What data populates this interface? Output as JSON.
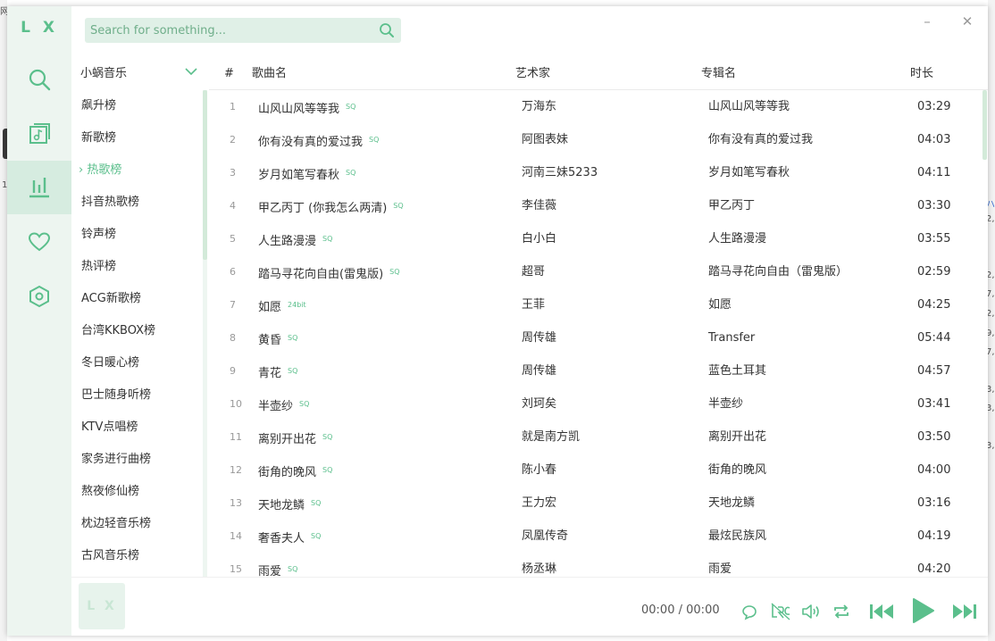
{
  "app": {
    "logo": "L X"
  },
  "search": {
    "placeholder": "Search for something..."
  },
  "window": {
    "minimize": "–",
    "close": "✕"
  },
  "sidebar_nav": [
    "search-icon",
    "music-library-icon",
    "chart-icon",
    "heart-icon",
    "settings-hex-icon"
  ],
  "source": {
    "selected": "小蜗音乐"
  },
  "chart_lists": [
    "飙升榜",
    "新歌榜",
    "热歌榜",
    "抖音热歌榜",
    "铃声榜",
    "热评榜",
    "ACG新歌榜",
    "台湾KKBOX榜",
    "冬日暖心榜",
    "巴士随身听榜",
    "KTV点唱榜",
    "家务进行曲榜",
    "熬夜修仙榜",
    "枕边轻音乐榜",
    "古风音乐榜"
  ],
  "active_list_marker": "›",
  "table": {
    "headers": {
      "num": "#",
      "name": "歌曲名",
      "artist": "艺术家",
      "album": "专辑名",
      "duration": "时长"
    },
    "rows": [
      {
        "num": "1",
        "name": "山风山风等等我",
        "tag": "SQ",
        "artist": "万海东",
        "album": "山风山风等等我",
        "duration": "03:29"
      },
      {
        "num": "2",
        "name": "你有没有真的爱过我",
        "tag": "SQ",
        "artist": "阿图表妹",
        "album": "你有没有真的爱过我",
        "duration": "04:03"
      },
      {
        "num": "3",
        "name": "岁月如笔写春秋",
        "tag": "SQ",
        "artist": "河南三妹5233",
        "album": "岁月如笔写春秋",
        "duration": "04:11"
      },
      {
        "num": "4",
        "name": "甲乙丙丁 (你我怎么两清)",
        "tag": "SQ",
        "artist": "李佳薇",
        "album": "甲乙丙丁",
        "duration": "03:30"
      },
      {
        "num": "5",
        "name": "人生路漫漫",
        "tag": "SQ",
        "artist": "白小白",
        "album": "人生路漫漫",
        "duration": "03:55"
      },
      {
        "num": "6",
        "name": "踏马寻花向自由(雷鬼版)",
        "tag": "SQ",
        "artist": "超哥",
        "album": "踏马寻花向自由（雷鬼版）",
        "duration": "02:59"
      },
      {
        "num": "7",
        "name": "如愿",
        "tag": "24bit",
        "artist": "王菲",
        "album": "如愿",
        "duration": "04:25"
      },
      {
        "num": "8",
        "name": "黄昏",
        "tag": "SQ",
        "artist": "周传雄",
        "album": "Transfer",
        "duration": "05:44"
      },
      {
        "num": "9",
        "name": "青花",
        "tag": "SQ",
        "artist": "周传雄",
        "album": "蓝色土耳其",
        "duration": "04:57"
      },
      {
        "num": "10",
        "name": "半壶纱",
        "tag": "SQ",
        "artist": "刘珂矣",
        "album": "半壶纱",
        "duration": "03:41"
      },
      {
        "num": "11",
        "name": "离别开出花",
        "tag": "SQ",
        "artist": "就是南方凯",
        "album": "离别开出花",
        "duration": "03:50"
      },
      {
        "num": "12",
        "name": "街角的晚风",
        "tag": "SQ",
        "artist": "陈小春",
        "album": "街角的晚风",
        "duration": "04:00"
      },
      {
        "num": "13",
        "name": "天地龙鳞",
        "tag": "SQ",
        "artist": "王力宏",
        "album": "天地龙鳞",
        "duration": "03:16"
      },
      {
        "num": "14",
        "name": "奢香夫人",
        "tag": "SQ",
        "artist": "凤凰传奇",
        "album": "最炫民族风",
        "duration": "04:19"
      },
      {
        "num": "15",
        "name": "雨爱",
        "tag": "SQ",
        "artist": "杨丞琳",
        "album": "雨爱",
        "duration": "04:20"
      }
    ]
  },
  "player": {
    "cover_logo": "L X",
    "time_current": "00:00",
    "time_separator": "/",
    "time_total": "00:00",
    "controls": [
      "loop-comment-icon",
      "lyrics-icon",
      "volume-icon",
      "repeat-icon",
      "previous-icon",
      "play-icon",
      "next-icon"
    ]
  },
  "colors": {
    "accent": "#5bbf8c",
    "sidebar_bg": "#edf5f0",
    "search_bg": "#e0f0e7"
  },
  "background_window": {
    "glyphs": [
      "网",
      "1",
      "ハ",
      "2,",
      "2,",
      "7,",
      "2,",
      "9,",
      "7,",
      "3,",
      "3,",
      "3,"
    ]
  }
}
